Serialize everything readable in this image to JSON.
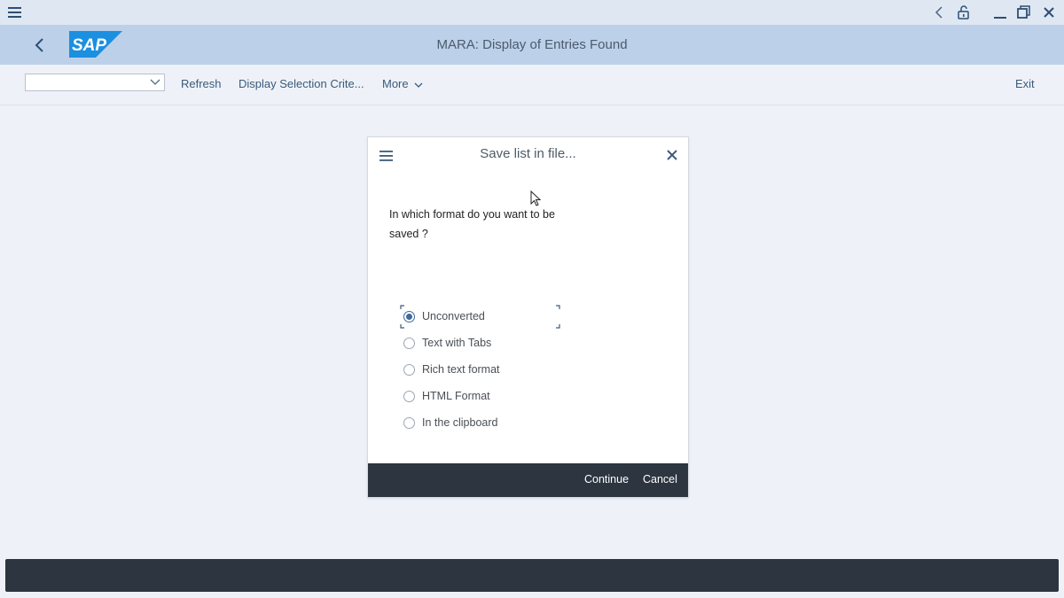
{
  "header": {
    "title": "MARA: Display of Entries Found",
    "logo_text": "SAP"
  },
  "toolbar": {
    "dropdown_value": "",
    "refresh_label": "Refresh",
    "display_selection_label": "Display Selection Crite...",
    "more_label": "More",
    "exit_label": "Exit"
  },
  "dialog": {
    "title": "Save list in file...",
    "question": "In which format do you want to be saved ?",
    "options": [
      {
        "label": "Unconverted",
        "selected": true
      },
      {
        "label": "Text with Tabs",
        "selected": false
      },
      {
        "label": "Rich text format",
        "selected": false
      },
      {
        "label": "HTML Format",
        "selected": false
      },
      {
        "label": "In the clipboard",
        "selected": false
      }
    ],
    "continue_label": "Continue",
    "cancel_label": "Cancel"
  },
  "icons": {
    "window_menu": "hamburger-icon",
    "window_controls": [
      "chevron-left-icon",
      "unlock-icon",
      "minimize-icon",
      "restore-icon",
      "close-icon"
    ],
    "back": "back-arrow-icon",
    "dialog_menu": "hamburger-icon",
    "dialog_close": "close-icon"
  },
  "colors": {
    "shell_bg": "#bcd0e9",
    "accent": "#3d6b9c",
    "footer_bg": "#2c3540",
    "sap_blue": "#1b8fe0"
  }
}
